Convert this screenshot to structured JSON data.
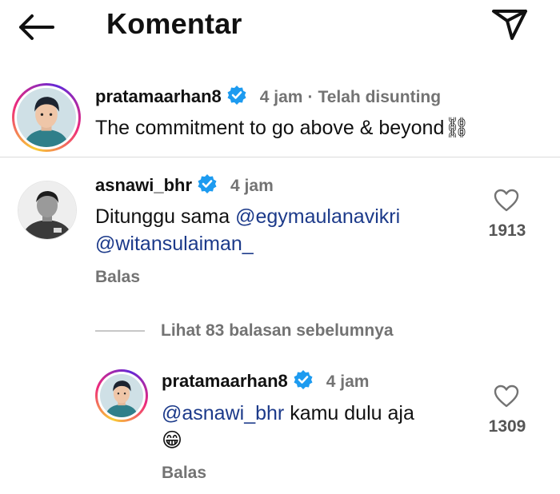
{
  "header": {
    "title": "Komentar",
    "back_icon": "arrow-left-icon",
    "send_icon": "paper-plane-icon"
  },
  "caption": {
    "username": "pratamaarhan8",
    "verified": true,
    "time": "4 jam",
    "separator": "·",
    "edited": "Telah disunting",
    "text": "The commitment to go above & beyond⛓"
  },
  "comments": [
    {
      "username": "asnawi_bhr",
      "verified": true,
      "time": "4 jam",
      "text_plain": "Ditunggu sama ",
      "mention_1": "@egymaulanavikri",
      "mention_2": "@witansulaiman_",
      "reply_label": "Balas",
      "likes": "1913"
    }
  ],
  "view_replies": "Lihat 83 balasan sebelumnya",
  "reply": {
    "username": "pratamaarhan8",
    "verified": true,
    "time": "4 jam",
    "mention": "@asnawi_bhr",
    "text": " kamu dulu aja",
    "emoji": "😁",
    "reply_label": "Balas",
    "likes": "1309"
  },
  "colors": {
    "mention": "#1c3a8a",
    "verified": "#1d9bf0",
    "meta_gray": "#737373",
    "divider": "#dbdbdb"
  }
}
